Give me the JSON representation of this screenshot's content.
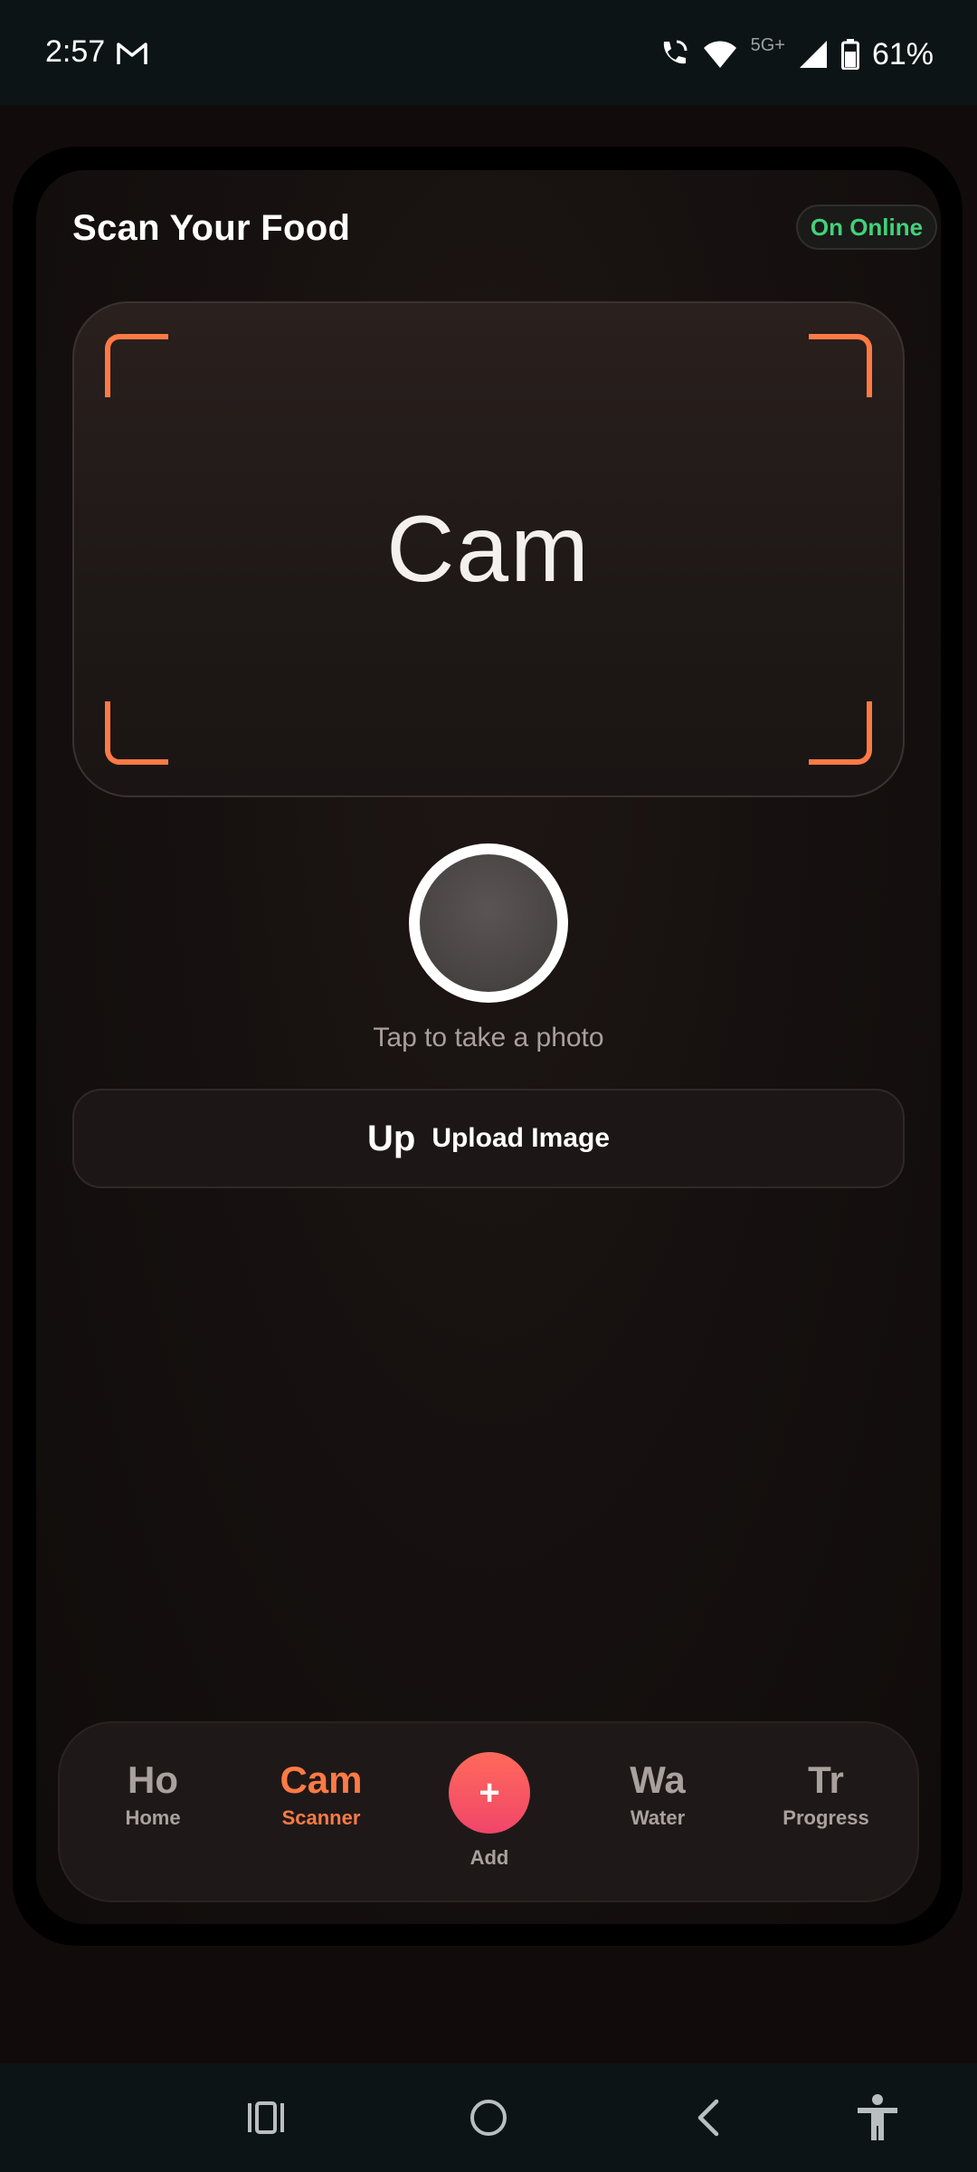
{
  "status_bar": {
    "time": "2:57",
    "network": "5G+",
    "battery": "61%",
    "icons": [
      "gmail-icon",
      "wifi-calling-icon",
      "wifi-icon",
      "signal-icon",
      "battery-icon"
    ]
  },
  "header": {
    "title": "Scan Your Food",
    "status_pill": "On Online",
    "status_color": "#43d17a"
  },
  "camera": {
    "placeholder": "Cam",
    "corner_color": "#ff7a45",
    "shutter_hint": "Tap to take a photo"
  },
  "upload": {
    "icon_text": "Up",
    "label": "Upload Image"
  },
  "bottom_nav": {
    "accent": "#ff7a45",
    "items": [
      {
        "icon": "Ho",
        "label": "Home",
        "active": false
      },
      {
        "icon": "Cam",
        "label": "Scanner",
        "active": true
      },
      {
        "icon": "Wa",
        "label": "Water",
        "active": false
      },
      {
        "icon": "Tr",
        "label": "Progress",
        "active": false
      }
    ],
    "add": {
      "icon": "+",
      "label": "Add"
    }
  },
  "system_nav": {
    "icons": [
      "recents-icon",
      "home-circle-icon",
      "back-chevron-icon",
      "accessibility-icon"
    ]
  }
}
